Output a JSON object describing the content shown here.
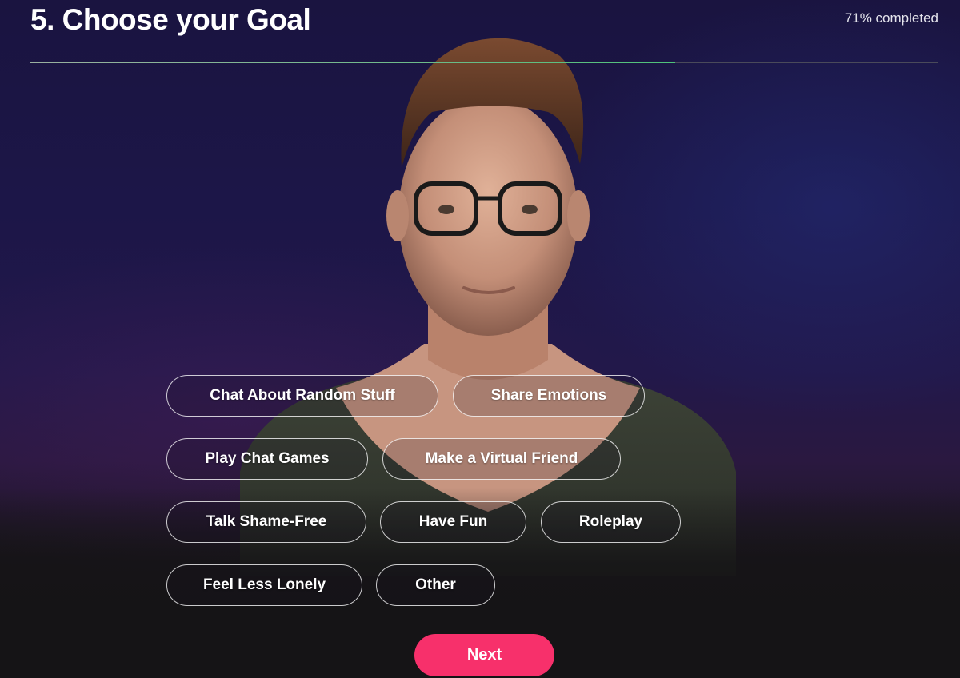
{
  "header": {
    "title": "5. Choose your Goal",
    "progress_text": "71% completed",
    "progress_fraction": 0.71
  },
  "goals": [
    "Chat About Random Stuff",
    "Share Emotions",
    "Play Chat Games",
    "Make a Virtual Friend",
    "Talk Shame-Free",
    "Have Fun",
    "Roleplay",
    "Feel Less Lonely",
    "Other"
  ],
  "footer": {
    "next_label": "Next"
  },
  "colors": {
    "accent": "#f7306b",
    "progress": "#4fc37a"
  }
}
